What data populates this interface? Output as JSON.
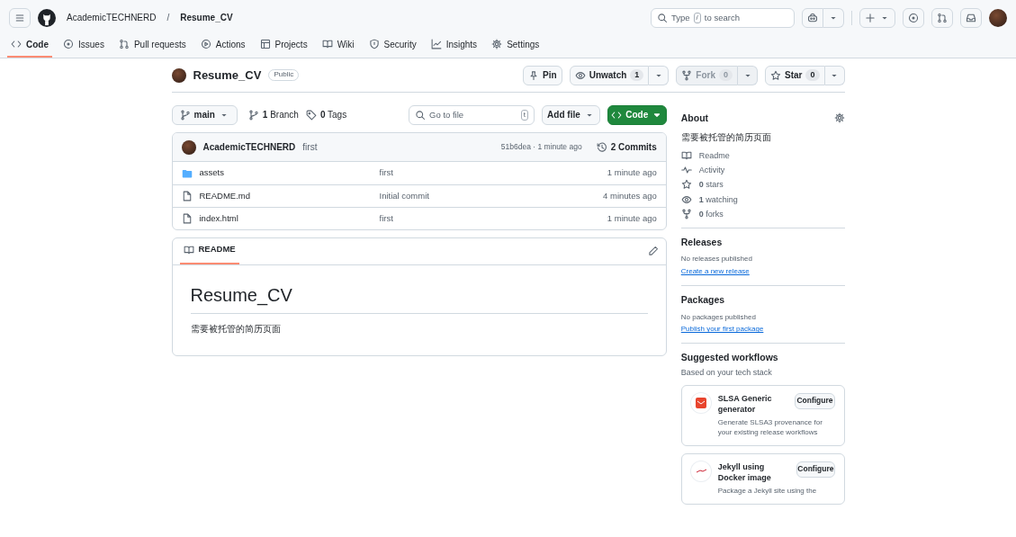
{
  "header": {
    "owner": "AcademicTECHNERD",
    "separator": "/",
    "repo": "Resume_CV",
    "search": {
      "before": "Type",
      "key": "/",
      "after": "to search"
    }
  },
  "tabs": [
    {
      "label": "Code",
      "selected": true
    },
    {
      "label": "Issues",
      "selected": false
    },
    {
      "label": "Pull requests",
      "selected": false
    },
    {
      "label": "Actions",
      "selected": false
    },
    {
      "label": "Projects",
      "selected": false
    },
    {
      "label": "Wiki",
      "selected": false
    },
    {
      "label": "Security",
      "selected": false
    },
    {
      "label": "Insights",
      "selected": false
    },
    {
      "label": "Settings",
      "selected": false
    }
  ],
  "repo": {
    "name": "Resume_CV",
    "visibility": "Public",
    "actions": [
      {
        "label": "Pin",
        "disabled": false
      },
      {
        "label": "Unwatch",
        "count": "1",
        "disabled": false
      },
      {
        "label": "Fork",
        "count": "0",
        "disabled": true
      },
      {
        "label": "Star",
        "count": "0",
        "disabled": false
      }
    ]
  },
  "toolbar": {
    "branch": "main",
    "branches": "**1** Branch",
    "tags": "**0** Tags",
    "goto_placeholder": "Go to file",
    "goto_key": "t",
    "add_file": "Add file",
    "code": "Code"
  },
  "commit": {
    "author": "AcademicTECHNERD",
    "message": "first",
    "meta": "51b6dea · 1 minute ago",
    "commits": "2 Commits"
  },
  "files": [
    {
      "kind": "folder",
      "name": "assets",
      "message": "first",
      "time": "1 minute ago"
    },
    {
      "kind": "file",
      "name": "README.md",
      "message": "Initial commit",
      "time": "4 minutes ago"
    },
    {
      "kind": "file",
      "name": "index.html",
      "message": "first",
      "time": "1 minute ago"
    }
  ],
  "readme": {
    "tab": "README",
    "title": "Resume_CV",
    "body": "需要被托管的简历页面"
  },
  "about": {
    "title": "About",
    "description": "需要被托管的简历页面",
    "links": [
      {
        "label": "Readme"
      },
      {
        "label": "Activity"
      },
      {
        "label": "**0** stars"
      },
      {
        "label": "**1** watching"
      },
      {
        "label": "**0** forks"
      }
    ]
  },
  "sections": [
    {
      "title": "Releases",
      "empty": "No releases published",
      "link": "Create a new release"
    },
    {
      "title": "Packages",
      "empty": "No packages published",
      "link": "Publish your first package"
    }
  ],
  "workflows": {
    "title": "Suggested workflows",
    "subtitle": "Based on your tech stack",
    "items": [
      {
        "title": "SLSA Generic generator",
        "description": "Generate SLSA3 provenance for your existing release workflows",
        "button": "Configure"
      },
      {
        "title": "Jekyll using Docker image",
        "description": "Package a Jekyll site using the",
        "button": "Configure"
      }
    ]
  }
}
